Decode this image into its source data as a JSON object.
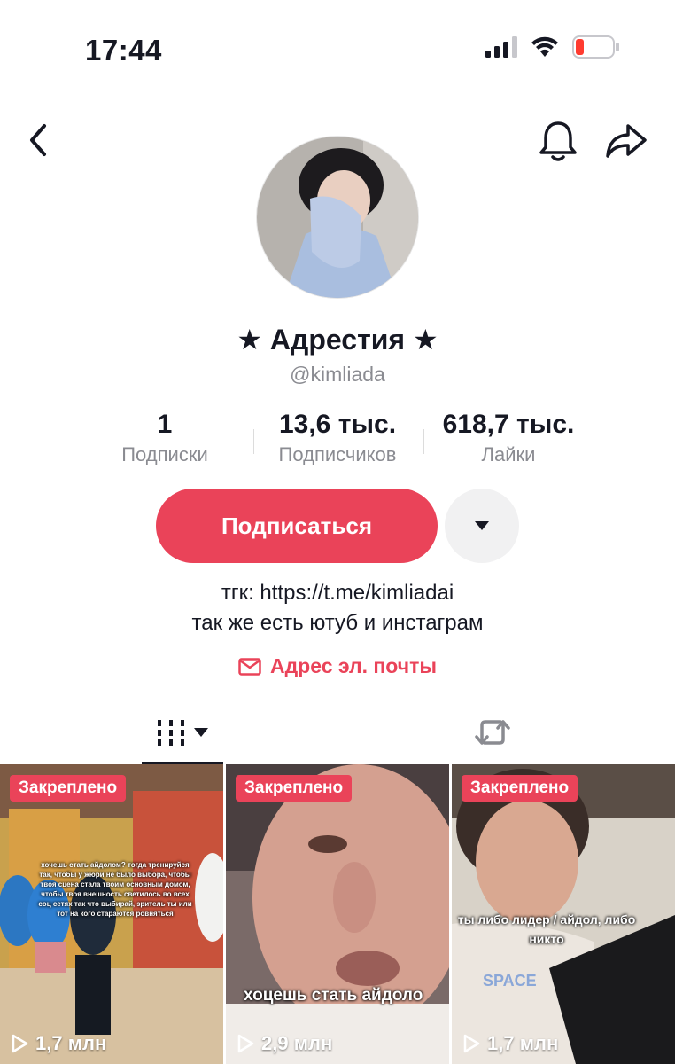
{
  "status_bar": {
    "time": "17:44",
    "battery_color": "#ff3b30"
  },
  "nav": {
    "back_icon": "chevron-left-icon",
    "bell_icon": "bell-icon",
    "share_icon": "share-arrow-icon"
  },
  "profile": {
    "display_name": "★ Адрестия ★",
    "username": "@kimliada",
    "stats": [
      {
        "value": "1",
        "label": "Подписки"
      },
      {
        "value": "13,6 тыс.",
        "label": "Подписчиков"
      },
      {
        "value": "618,7 тыс.",
        "label": "Лайки"
      }
    ],
    "follow_label": "Подписаться",
    "bio_line1": "тгк: https://t.me/kimliadai",
    "bio_line2": "так же есть ютуб и инстаграм",
    "email_label": "Адрес эл. почты",
    "accent_color": "#ea4359"
  },
  "tabs": [
    {
      "name": "videos",
      "icon": "grid-columns-icon",
      "active": true
    },
    {
      "name": "reposts",
      "icon": "repost-icon",
      "active": false
    }
  ],
  "videos": [
    {
      "badge": "Закреплено",
      "views": "1,7 млн",
      "overlay": "хочешь стать айдолом? тогда тренируйся так, чтобы у жюри не было выбора, чтобы твоя сцена стала твоим основным домом, чтобы твоя внешность светилось во всех соц сетях так что выбирай, зритель ты или тот на кого стараются ровняться"
    },
    {
      "badge": "Закреплено",
      "views": "2,9 млн",
      "overlay": "хоцешь стать айдоло"
    },
    {
      "badge": "Закреплено",
      "views": "1,7 млн",
      "overlay": "ты либо лидер / айдол, либо никто",
      "shirt_text": "SPACE"
    }
  ]
}
